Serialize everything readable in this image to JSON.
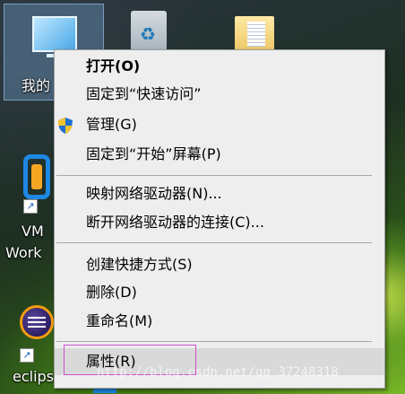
{
  "desktop": {
    "icons": [
      {
        "label": "我的"
      },
      {
        "label": ""
      },
      {
        "label": ""
      },
      {
        "label": "VM\nWork"
      },
      {
        "label": "eclipse"
      }
    ]
  },
  "context_menu": {
    "items": [
      {
        "label": "打开(O)",
        "bold": true
      },
      {
        "label": "固定到“快速访问”"
      },
      {
        "label": "管理(G)",
        "icon": "uac-shield-icon"
      },
      {
        "label": "固定到“开始”屏幕(P)"
      },
      {
        "label": "映射网络驱动器(N)..."
      },
      {
        "label": "断开网络驱动器的连接(C)..."
      },
      {
        "label": "创建快捷方式(S)"
      },
      {
        "label": "删除(D)"
      },
      {
        "label": "重命名(M)"
      },
      {
        "label": "属性(R)",
        "highlighted": true
      }
    ]
  },
  "watermark": "http://blog.csdn.net/qq_37248318",
  "colors": {
    "menu_bg": "#eeeeee",
    "hover": "#d9d9d9",
    "highlight_box": "#d050d0"
  }
}
